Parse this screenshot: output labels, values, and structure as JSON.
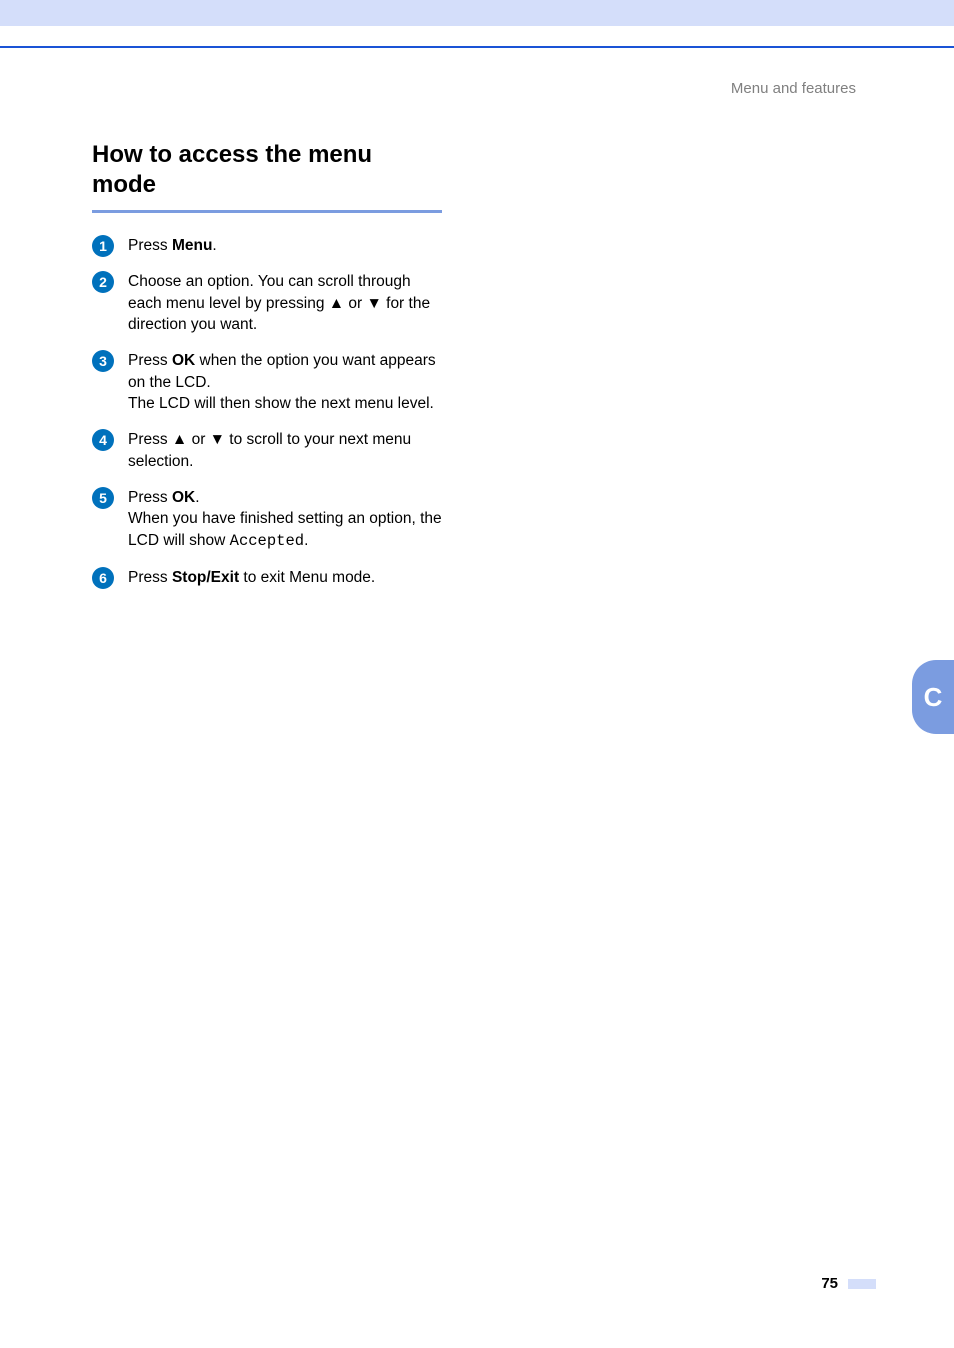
{
  "header": {
    "section_label": "Menu and features"
  },
  "title": "How to access the menu mode",
  "steps": [
    {
      "num": "1",
      "parts": [
        {
          "t": "Press "
        },
        {
          "t": "Menu",
          "b": true
        },
        {
          "t": "."
        }
      ]
    },
    {
      "num": "2",
      "parts": [
        {
          "t": "Choose an option. You can scroll through each menu level by pressing ▲ or ▼ for the direction you want."
        }
      ]
    },
    {
      "num": "3",
      "parts": [
        {
          "t": "Press "
        },
        {
          "t": "OK",
          "b": true
        },
        {
          "t": " when the option you want appears on the LCD."
        },
        {
          "br": true
        },
        {
          "t": "The LCD will then show the next menu level."
        }
      ]
    },
    {
      "num": "4",
      "parts": [
        {
          "t": "Press ▲ or ▼ to scroll to your next menu selection."
        }
      ]
    },
    {
      "num": "5",
      "parts": [
        {
          "t": "Press "
        },
        {
          "t": "OK",
          "b": true
        },
        {
          "t": "."
        },
        {
          "br": true
        },
        {
          "t": "When you have finished setting an option, the LCD will show "
        },
        {
          "t": "Accepted",
          "mono": true
        },
        {
          "t": "."
        }
      ]
    },
    {
      "num": "6",
      "parts": [
        {
          "t": "Press "
        },
        {
          "t": "Stop/Exit",
          "b": true
        },
        {
          "t": " to exit Menu mode."
        }
      ]
    }
  ],
  "side_tab": "C",
  "page_number": "75"
}
